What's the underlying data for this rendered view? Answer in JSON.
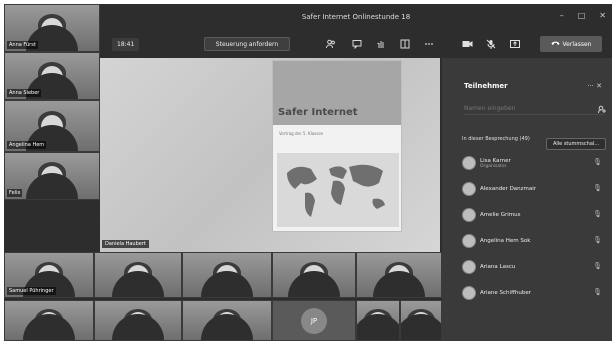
{
  "window": {
    "title": "Safer Internet Onlinestunde 18",
    "controls": [
      "–",
      "□",
      "✕"
    ]
  },
  "toolbar": {
    "timer": "18:41",
    "request_control_label": "Steuerung anfordern",
    "leave_label": "Verlassen"
  },
  "icons": {
    "participants": "people-icon",
    "chat": "chat-icon",
    "reactions": "hand-icon",
    "rooms": "breakout-icon",
    "more": "more-icon",
    "camera": "camera-icon",
    "mic": "mic-muted-icon",
    "share": "share-tray-icon",
    "phone": "phone-icon"
  },
  "slide": {
    "title": "Safer Internet",
    "subtitle": "Vortrag der 5. Klassen",
    "presenter_tag": "Daniela Haubert"
  },
  "left_tiles": [
    {
      "name": "Anna Fürst"
    },
    {
      "name": "Anna Sieber"
    },
    {
      "name": "Angelina Hem"
    },
    {
      "name": "Felix"
    }
  ],
  "bottom_tiles_row1": [
    {
      "name": "Samuel Pühringer"
    },
    {
      "name": ""
    },
    {
      "name": ""
    },
    {
      "name": ""
    },
    {
      "name": ""
    }
  ],
  "bottom_tiles_row2": [
    {
      "name": ""
    },
    {
      "name": ""
    },
    {
      "name": ""
    },
    {
      "name": "JP"
    },
    {
      "name": ""
    },
    {
      "name": ""
    }
  ],
  "panel": {
    "title": "Teilnehmer",
    "search_placeholder": "Namen eingeben",
    "section_label": "In dieser Besprechung (49)",
    "mute_all_label": "Alle stummschal..."
  },
  "participants": [
    {
      "name": "Lisa Karner",
      "role": "Organisator"
    },
    {
      "name": "Alexander Danzmair",
      "role": ""
    },
    {
      "name": "Amelie Grimus",
      "role": ""
    },
    {
      "name": "Angelina Hem Sok",
      "role": ""
    },
    {
      "name": "Ariana Lascu",
      "role": ""
    },
    {
      "name": "Ariane Schiffhuber",
      "role": ""
    }
  ]
}
